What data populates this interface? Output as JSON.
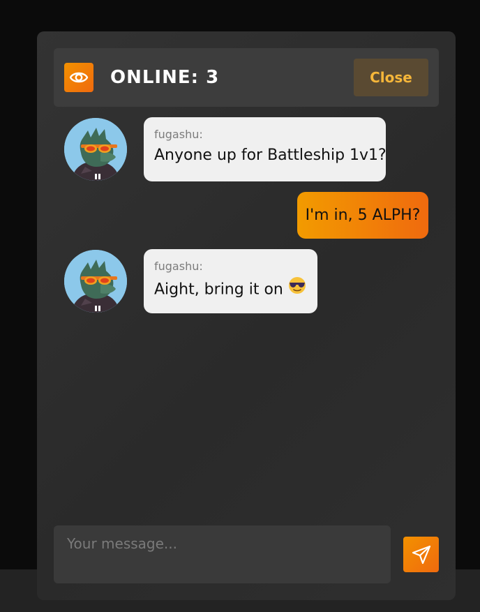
{
  "header": {
    "online_label": "ONLINE: 3",
    "close_label": "Close",
    "eye_icon": "eye-icon"
  },
  "messages": [
    {
      "direction": "incoming",
      "sender": "fugashu:",
      "text": "Anyone up for Battleship 1v1?",
      "avatar": "lizard-with-sunglasses-avatar"
    },
    {
      "direction": "outgoing",
      "text": "I'm in, 5 ALPH?"
    },
    {
      "direction": "incoming",
      "sender": "fugashu:",
      "text": "Aight, bring it on",
      "emoji": "smiling-face-with-sunglasses",
      "avatar": "lizard-with-sunglasses-avatar"
    }
  ],
  "composer": {
    "placeholder": "Your message...",
    "value": "",
    "send_icon": "paper-plane-icon"
  },
  "colors": {
    "accent_orange": "#f29100",
    "accent_orange_dark": "#f06a0e",
    "close_text": "#f5b63a",
    "panel_bg": "#2e2e2e",
    "page_bg": "#0b0b0b",
    "incoming_bubble": "#f0f0f0"
  }
}
